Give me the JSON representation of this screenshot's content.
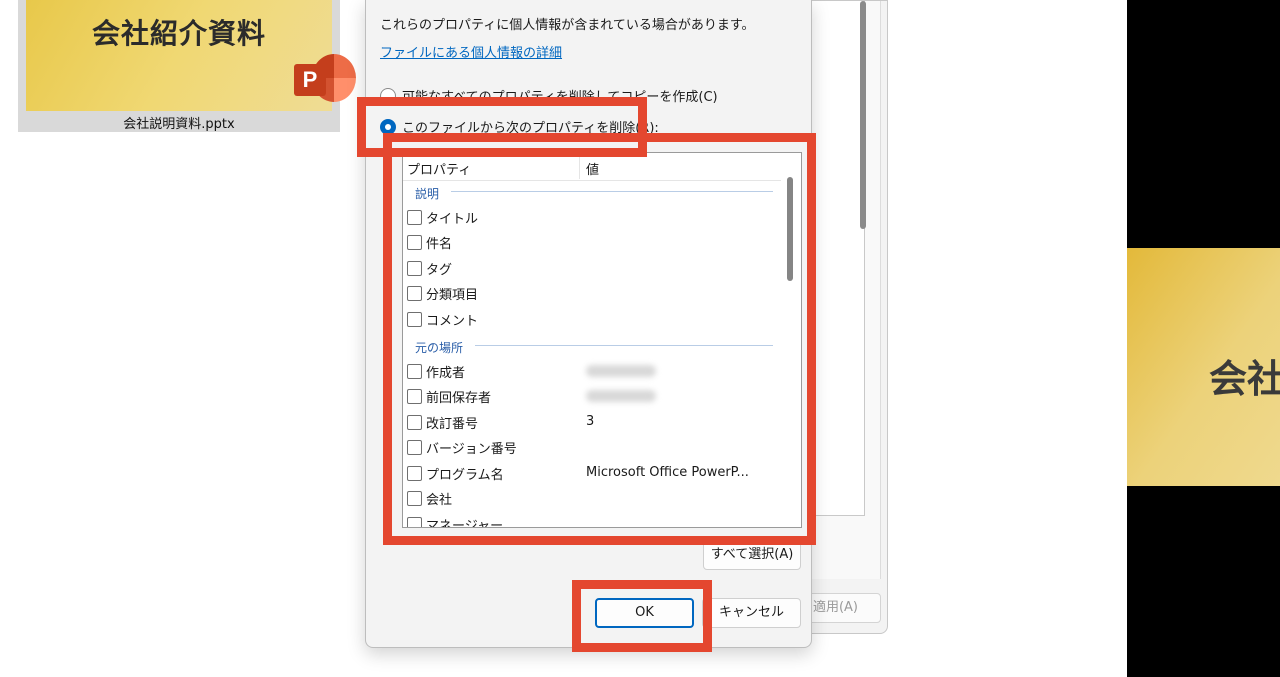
{
  "thumbnail": {
    "slide_title": "会社紹介資料",
    "app_icon": "powerpoint-icon",
    "app_letter": "P",
    "file_name": "会社説明資料.pptx"
  },
  "right_slide": {
    "title_fragment": "会社"
  },
  "back_window": {
    "apply_label": "適用(A)"
  },
  "dialog": {
    "description": "これらのプロパティに個人情報が含まれている場合があります。",
    "details_link": "ファイルにある個人情報の詳細",
    "option_copy": "可能なすべてのプロパティを削除してコピーを作成(C)",
    "option_remove": "このファイルから次のプロパティを削除(R):",
    "columns": {
      "property": "プロパティ",
      "value": "値"
    },
    "groups": [
      {
        "label": "説明",
        "items": [
          {
            "name": "タイトル",
            "value": ""
          },
          {
            "name": "件名",
            "value": ""
          },
          {
            "name": "タグ",
            "value": ""
          },
          {
            "name": "分類項目",
            "value": ""
          },
          {
            "name": "コメント",
            "value": ""
          }
        ]
      },
      {
        "label": "元の場所",
        "items": [
          {
            "name": "作成者",
            "value": ""
          },
          {
            "name": "前回保存者",
            "value": ""
          },
          {
            "name": "改訂番号",
            "value": "3"
          },
          {
            "name": "バージョン番号",
            "value": ""
          },
          {
            "name": "プログラム名",
            "value": "Microsoft Office PowerP..."
          },
          {
            "name": "会社",
            "value": ""
          },
          {
            "name": "マネージャー",
            "value": ""
          }
        ]
      }
    ],
    "select_all_label": "すべて選択(A)",
    "ok_label": "OK",
    "cancel_label": "キャンセル"
  },
  "colors": {
    "highlight": "#e4472f",
    "accent": "#0067c0",
    "link": "#0067c0"
  }
}
